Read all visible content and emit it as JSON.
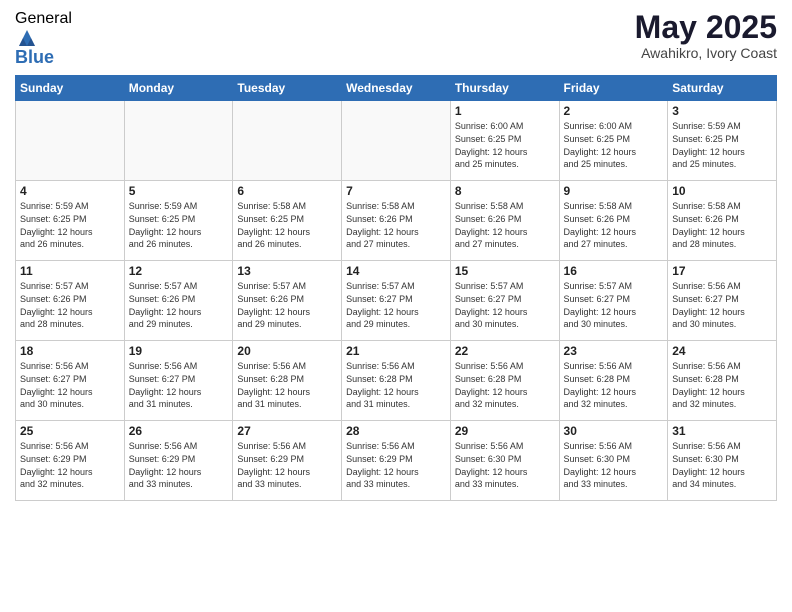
{
  "header": {
    "logo_general": "General",
    "logo_blue": "Blue",
    "month": "May 2025",
    "location": "Awahikro, Ivory Coast"
  },
  "weekdays": [
    "Sunday",
    "Monday",
    "Tuesday",
    "Wednesday",
    "Thursday",
    "Friday",
    "Saturday"
  ],
  "weeks": [
    [
      {
        "day": "",
        "info": ""
      },
      {
        "day": "",
        "info": ""
      },
      {
        "day": "",
        "info": ""
      },
      {
        "day": "",
        "info": ""
      },
      {
        "day": "1",
        "info": "Sunrise: 6:00 AM\nSunset: 6:25 PM\nDaylight: 12 hours\nand 25 minutes."
      },
      {
        "day": "2",
        "info": "Sunrise: 6:00 AM\nSunset: 6:25 PM\nDaylight: 12 hours\nand 25 minutes."
      },
      {
        "day": "3",
        "info": "Sunrise: 5:59 AM\nSunset: 6:25 PM\nDaylight: 12 hours\nand 25 minutes."
      }
    ],
    [
      {
        "day": "4",
        "info": "Sunrise: 5:59 AM\nSunset: 6:25 PM\nDaylight: 12 hours\nand 26 minutes."
      },
      {
        "day": "5",
        "info": "Sunrise: 5:59 AM\nSunset: 6:25 PM\nDaylight: 12 hours\nand 26 minutes."
      },
      {
        "day": "6",
        "info": "Sunrise: 5:58 AM\nSunset: 6:25 PM\nDaylight: 12 hours\nand 26 minutes."
      },
      {
        "day": "7",
        "info": "Sunrise: 5:58 AM\nSunset: 6:26 PM\nDaylight: 12 hours\nand 27 minutes."
      },
      {
        "day": "8",
        "info": "Sunrise: 5:58 AM\nSunset: 6:26 PM\nDaylight: 12 hours\nand 27 minutes."
      },
      {
        "day": "9",
        "info": "Sunrise: 5:58 AM\nSunset: 6:26 PM\nDaylight: 12 hours\nand 27 minutes."
      },
      {
        "day": "10",
        "info": "Sunrise: 5:58 AM\nSunset: 6:26 PM\nDaylight: 12 hours\nand 28 minutes."
      }
    ],
    [
      {
        "day": "11",
        "info": "Sunrise: 5:57 AM\nSunset: 6:26 PM\nDaylight: 12 hours\nand 28 minutes."
      },
      {
        "day": "12",
        "info": "Sunrise: 5:57 AM\nSunset: 6:26 PM\nDaylight: 12 hours\nand 29 minutes."
      },
      {
        "day": "13",
        "info": "Sunrise: 5:57 AM\nSunset: 6:26 PM\nDaylight: 12 hours\nand 29 minutes."
      },
      {
        "day": "14",
        "info": "Sunrise: 5:57 AM\nSunset: 6:27 PM\nDaylight: 12 hours\nand 29 minutes."
      },
      {
        "day": "15",
        "info": "Sunrise: 5:57 AM\nSunset: 6:27 PM\nDaylight: 12 hours\nand 30 minutes."
      },
      {
        "day": "16",
        "info": "Sunrise: 5:57 AM\nSunset: 6:27 PM\nDaylight: 12 hours\nand 30 minutes."
      },
      {
        "day": "17",
        "info": "Sunrise: 5:56 AM\nSunset: 6:27 PM\nDaylight: 12 hours\nand 30 minutes."
      }
    ],
    [
      {
        "day": "18",
        "info": "Sunrise: 5:56 AM\nSunset: 6:27 PM\nDaylight: 12 hours\nand 30 minutes."
      },
      {
        "day": "19",
        "info": "Sunrise: 5:56 AM\nSunset: 6:27 PM\nDaylight: 12 hours\nand 31 minutes."
      },
      {
        "day": "20",
        "info": "Sunrise: 5:56 AM\nSunset: 6:28 PM\nDaylight: 12 hours\nand 31 minutes."
      },
      {
        "day": "21",
        "info": "Sunrise: 5:56 AM\nSunset: 6:28 PM\nDaylight: 12 hours\nand 31 minutes."
      },
      {
        "day": "22",
        "info": "Sunrise: 5:56 AM\nSunset: 6:28 PM\nDaylight: 12 hours\nand 32 minutes."
      },
      {
        "day": "23",
        "info": "Sunrise: 5:56 AM\nSunset: 6:28 PM\nDaylight: 12 hours\nand 32 minutes."
      },
      {
        "day": "24",
        "info": "Sunrise: 5:56 AM\nSunset: 6:28 PM\nDaylight: 12 hours\nand 32 minutes."
      }
    ],
    [
      {
        "day": "25",
        "info": "Sunrise: 5:56 AM\nSunset: 6:29 PM\nDaylight: 12 hours\nand 32 minutes."
      },
      {
        "day": "26",
        "info": "Sunrise: 5:56 AM\nSunset: 6:29 PM\nDaylight: 12 hours\nand 33 minutes."
      },
      {
        "day": "27",
        "info": "Sunrise: 5:56 AM\nSunset: 6:29 PM\nDaylight: 12 hours\nand 33 minutes."
      },
      {
        "day": "28",
        "info": "Sunrise: 5:56 AM\nSunset: 6:29 PM\nDaylight: 12 hours\nand 33 minutes."
      },
      {
        "day": "29",
        "info": "Sunrise: 5:56 AM\nSunset: 6:30 PM\nDaylight: 12 hours\nand 33 minutes."
      },
      {
        "day": "30",
        "info": "Sunrise: 5:56 AM\nSunset: 6:30 PM\nDaylight: 12 hours\nand 33 minutes."
      },
      {
        "day": "31",
        "info": "Sunrise: 5:56 AM\nSunset: 6:30 PM\nDaylight: 12 hours\nand 34 minutes."
      }
    ]
  ]
}
